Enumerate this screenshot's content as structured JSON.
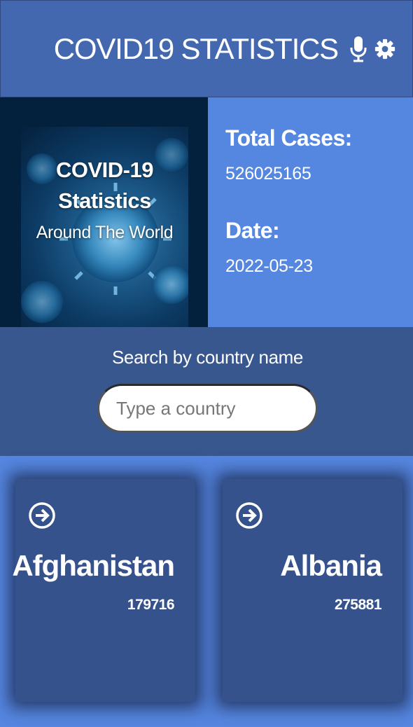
{
  "header": {
    "title": "COVID19 STATISTICS",
    "icons": [
      "microphone-icon",
      "gear-icon"
    ]
  },
  "hero": {
    "image_line1": "COVID-19",
    "image_line2": "Statistics",
    "image_line3": "Around The World",
    "total_cases_label": "Total Cases:",
    "total_cases_value": "526025165",
    "date_label": "Date:",
    "date_value": "2022-05-23"
  },
  "search": {
    "label": "Search by country name",
    "placeholder": "Type a country",
    "value": ""
  },
  "countries": [
    {
      "name": "Afghanistan",
      "cases": "179716",
      "icon": "arrow-circle-right-icon"
    },
    {
      "name": "Albania",
      "cases": "275881",
      "icon": "arrow-circle-right-icon"
    }
  ],
  "colors": {
    "header_bg": "#4468b0",
    "page_bg": "#5586e0",
    "hero_left_bg": "#03203c",
    "search_bg": "#38578f",
    "card_bg": "#36528c",
    "text": "#ffffff"
  }
}
